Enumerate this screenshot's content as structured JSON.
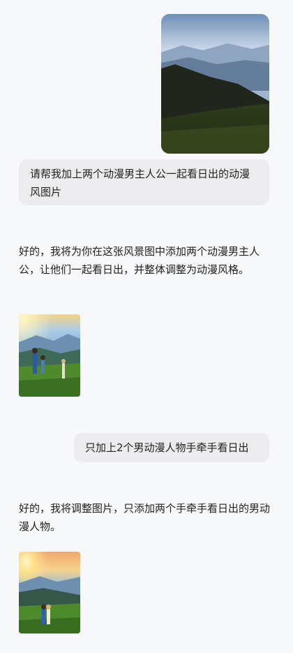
{
  "messages": [
    {
      "role": "user",
      "image_alt": "mountain landscape photo",
      "text": "请帮我加上两个动漫男主人公一起看日出的动漫风图片"
    },
    {
      "role": "assistant",
      "text": "好的，我将为你在这张风景图中添加两个动漫男主人公，让他们一起看日出，并整体调整为动漫风格。",
      "image_alt": "anime style sunrise with two characters"
    },
    {
      "role": "user",
      "text": "只加上2个男动漫人物手牵手看日出"
    },
    {
      "role": "assistant",
      "text": "好的，我将调整图片，只添加两个手牵手看日出的男动漫人物。",
      "image_alt": "anime style sunrise with two characters holding hands"
    }
  ],
  "colors": {
    "page_background": "#f7f8fa",
    "user_bubble": "#ececee",
    "text": "#222222"
  }
}
